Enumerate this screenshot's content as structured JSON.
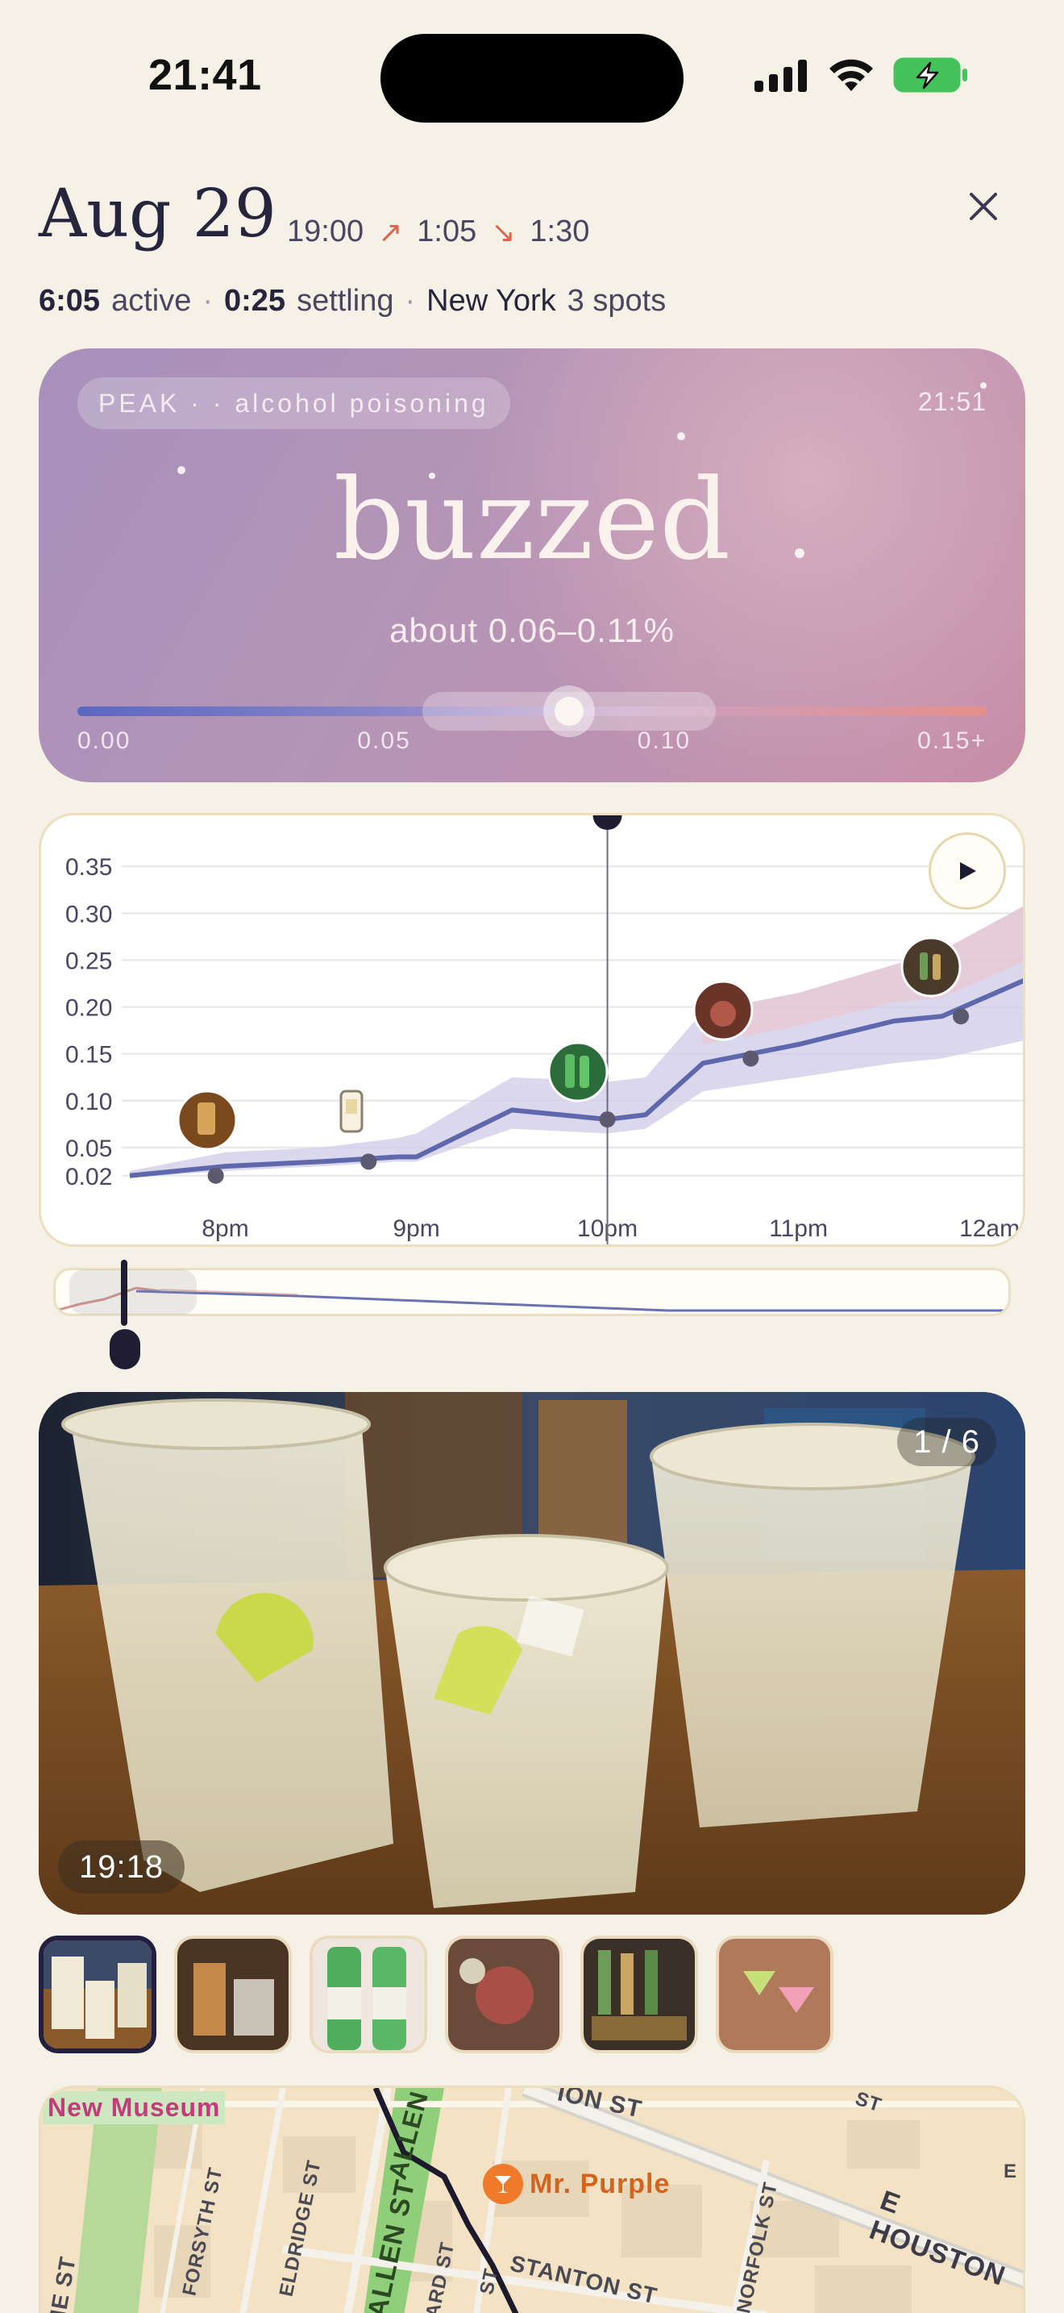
{
  "status_bar": {
    "time": "21:41"
  },
  "header": {
    "date": "Aug 29",
    "start_time": "19:00",
    "rise_duration": "1:05",
    "fall_duration": "1:30",
    "active_value": "6:05",
    "active_label": "active",
    "settling_value": "0:25",
    "settling_label": "settling",
    "city": "New York",
    "spots": "3 spots",
    "separator": "·"
  },
  "peak": {
    "pill_label": "PEAK · · alcohol poisoning",
    "time": "21:51",
    "level": "buzzed",
    "range": "about 0.06–0.11%",
    "scale_labels": [
      "0.00",
      "0.05",
      "0.10",
      "0.15+"
    ]
  },
  "chart_data": {
    "type": "line",
    "y_ticks": [
      "0.35",
      "0.30",
      "0.25",
      "0.20",
      "0.15",
      "0.10",
      "0.05",
      "0.02"
    ],
    "x_ticks": [
      "8pm",
      "9pm",
      "10pm",
      "11pm",
      "12am"
    ],
    "ylim": [
      0.0,
      0.37
    ],
    "xlim_hours": [
      19.5,
      24.2
    ],
    "cursor_time": 22.0,
    "series": [
      {
        "x": [
          19.5,
          20.0,
          20.5,
          20.9,
          21.0,
          21.5,
          22.0,
          22.2,
          22.5,
          23.0,
          23.5,
          23.75,
          24.2
        ],
        "y": [
          0.02,
          0.03,
          0.035,
          0.04,
          0.04,
          0.09,
          0.08,
          0.085,
          0.14,
          0.16,
          0.185,
          0.19,
          0.23
        ]
      }
    ],
    "band_upper": [
      0.025,
      0.045,
      0.05,
      0.06,
      0.065,
      0.125,
      0.12,
      0.125,
      0.195,
      0.215,
      0.245,
      0.26,
      0.31
    ],
    "band_lower": [
      0.018,
      0.025,
      0.03,
      0.035,
      0.035,
      0.07,
      0.065,
      0.07,
      0.11,
      0.125,
      0.14,
      0.145,
      0.165
    ],
    "drink_points": [
      {
        "x": 19.95,
        "y": 0.02
      },
      {
        "x": 20.75,
        "y": 0.035
      },
      {
        "x": 22.0,
        "y": 0.08
      },
      {
        "x": 22.75,
        "y": 0.145
      },
      {
        "x": 23.85,
        "y": 0.19
      }
    ]
  },
  "photo": {
    "counter": "1 / 6",
    "time": "19:18"
  },
  "map": {
    "labels": [
      "New Museum",
      "Mr. Purple",
      "E HOUSTON",
      "STANTON ST",
      "ALLEN ST",
      "ELDRIDGE ST",
      "FORSYTH ST",
      "NORFOLK ST",
      "ALLEN",
      "ION ST",
      "ST",
      "ARD ST",
      "IE ST",
      "ST",
      "E"
    ]
  },
  "colors": {
    "background": "#f6f1e6",
    "ink": "#27243e",
    "accent_warm": "#d9674f",
    "bac_line": "#5f68ad",
    "bac_band": "#c9c4e4",
    "bac_band_high": "#e8b8c4"
  },
  "icons": [
    "signal-icon",
    "wifi-icon",
    "battery-charging-icon",
    "arrow-up-right-icon",
    "arrow-down-right-icon",
    "close-icon",
    "play-icon",
    "cocktail-pin-icon"
  ]
}
